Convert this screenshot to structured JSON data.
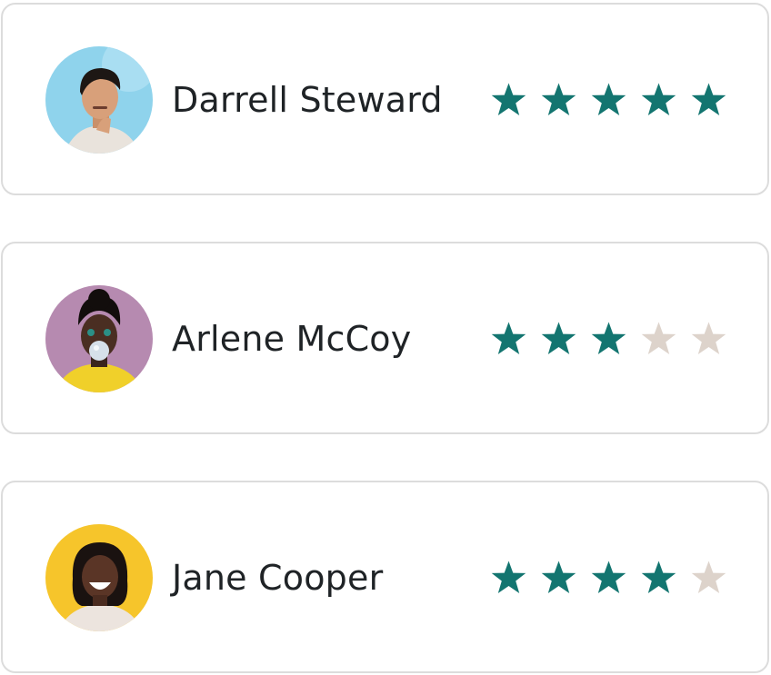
{
  "reviews": [
    {
      "name": "Darrell Steward",
      "rating": 5,
      "max_rating": 5,
      "avatar": "man-portrait-blue-background"
    },
    {
      "name": "Arlene McCoy",
      "rating": 3,
      "max_rating": 5,
      "avatar": "woman-bubblegum-pink-background"
    },
    {
      "name": "Jane Cooper",
      "rating": 4,
      "max_rating": 5,
      "avatar": "woman-laughing-yellow-background"
    }
  ],
  "colors": {
    "star_filled": "#137570",
    "star_empty": "#ddd3cb",
    "card_border": "#dcdcdc",
    "name_text": "#1f2326"
  },
  "icons": {
    "star": "star-icon"
  }
}
